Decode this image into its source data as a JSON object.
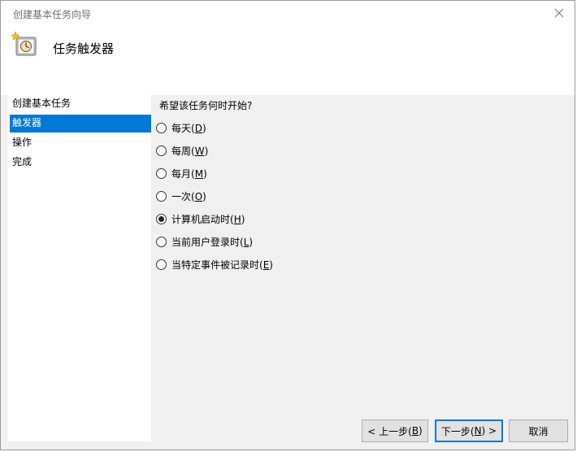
{
  "window": {
    "title": "创建基本任务向导"
  },
  "header": {
    "title": "任务触发器",
    "icon": "clock-icon"
  },
  "sidebar": {
    "items": [
      {
        "label": "创建基本任务",
        "selected": false
      },
      {
        "label": "触发器",
        "selected": true
      },
      {
        "label": "操作",
        "selected": false
      },
      {
        "label": "完成",
        "selected": false
      }
    ]
  },
  "main": {
    "question": "希望该任务何时开始?",
    "options": [
      {
        "label": "每天",
        "key": "D",
        "checked": false
      },
      {
        "label": "每周",
        "key": "W",
        "checked": false
      },
      {
        "label": "每月",
        "key": "M",
        "checked": false
      },
      {
        "label": "一次",
        "key": "O",
        "checked": false
      },
      {
        "label": "计算机启动时",
        "key": "H",
        "checked": true
      },
      {
        "label": "当前用户登录时",
        "key": "L",
        "checked": false
      },
      {
        "label": "当特定事件被记录时",
        "key": "E",
        "checked": false
      }
    ]
  },
  "buttons": {
    "back": {
      "prefix": "< 上一步(",
      "key": "B",
      "suffix": ")"
    },
    "next": {
      "prefix": "下一步(",
      "key": "N",
      "suffix": ") >"
    },
    "cancel": {
      "label": "取消"
    }
  },
  "colors": {
    "selection": "#0078d7",
    "window_bg": "#f0f0f0",
    "title_text": "#6d6d6d"
  }
}
